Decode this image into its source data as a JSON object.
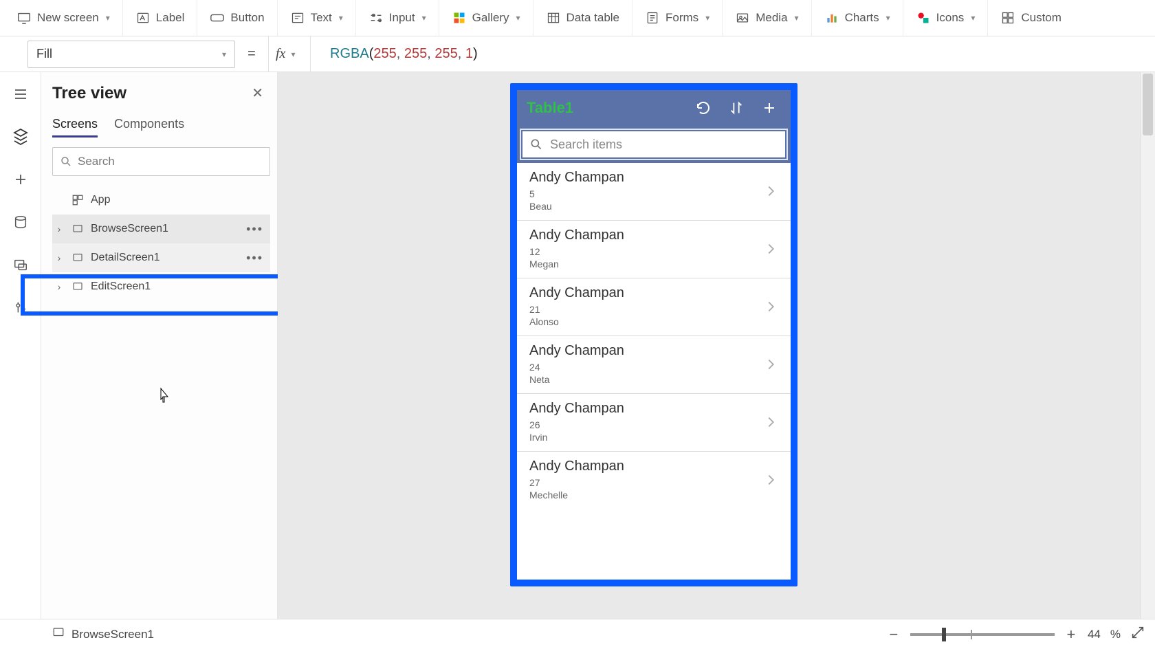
{
  "ribbon": {
    "new_screen": "New screen",
    "label": "Label",
    "button": "Button",
    "text": "Text",
    "input": "Input",
    "gallery": "Gallery",
    "data_table": "Data table",
    "forms": "Forms",
    "media": "Media",
    "charts": "Charts",
    "icons": "Icons",
    "custom": "Custom"
  },
  "formula_bar": {
    "property": "Fill",
    "fx": "fx",
    "formula_fn": "RGBA",
    "formula_args": [
      "255",
      "255",
      "255",
      "1"
    ]
  },
  "tree": {
    "title": "Tree view",
    "tab_screens": "Screens",
    "tab_components": "Components",
    "search_placeholder": "Search",
    "nodes": {
      "app": "App",
      "browse": "BrowseScreen1",
      "detail": "DetailScreen1",
      "edit": "EditScreen1"
    }
  },
  "preview": {
    "header_title": "Table1",
    "search_placeholder": "Search items",
    "items": [
      {
        "title": "Andy Champan",
        "sub1": "5",
        "sub2": "Beau"
      },
      {
        "title": "Andy Champan",
        "sub1": "12",
        "sub2": "Megan"
      },
      {
        "title": "Andy Champan",
        "sub1": "21",
        "sub2": "Alonso"
      },
      {
        "title": "Andy Champan",
        "sub1": "24",
        "sub2": "Neta"
      },
      {
        "title": "Andy Champan",
        "sub1": "26",
        "sub2": "Irvin"
      },
      {
        "title": "Andy Champan",
        "sub1": "27",
        "sub2": "Mechelle"
      }
    ]
  },
  "status": {
    "selected": "BrowseScreen1",
    "zoom_value": "44",
    "zoom_unit": "%"
  }
}
